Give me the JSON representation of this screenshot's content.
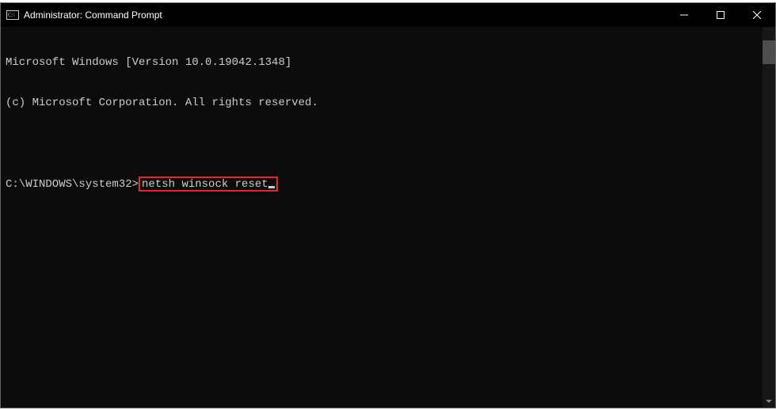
{
  "titlebar": {
    "title": "Administrator: Command Prompt"
  },
  "terminal": {
    "line1": "Microsoft Windows [Version 10.0.19042.1348]",
    "line2": "(c) Microsoft Corporation. All rights reserved.",
    "prompt": "C:\\WINDOWS\\system32>",
    "command": "netsh winsock reset"
  }
}
